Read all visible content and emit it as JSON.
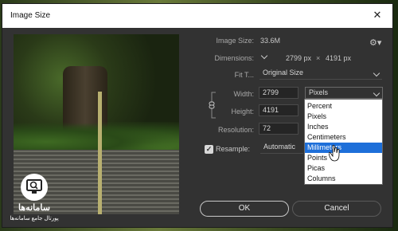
{
  "dialog": {
    "title": "Image Size"
  },
  "info": {
    "image_size_label": "Image Size:",
    "image_size_value": "33.6M",
    "dimensions_label": "Dimensions:",
    "dimensions_width": "2799 px",
    "dimensions_times": "×",
    "dimensions_height": "4191 px",
    "fit_label": "Fit T...",
    "fit_value": "Original Size"
  },
  "fields": {
    "width_label": "Width:",
    "width_value": "2799",
    "width_unit": "Pixels",
    "height_label": "Height:",
    "height_value": "4191",
    "resolution_label": "Resolution:",
    "resolution_value": "72",
    "resample_label": "Resample:",
    "resample_value": "Automatic"
  },
  "unit_options": [
    "Percent",
    "Pixels",
    "Inches",
    "Centimeters",
    "Millimeters",
    "Points",
    "Picas",
    "Columns"
  ],
  "selected_unit_option": "Millimeters",
  "buttons": {
    "ok": "OK",
    "cancel": "Cancel"
  },
  "watermark": {
    "name": "سامانه‌ها",
    "tagline": "پورتال جامع سامانه‌ها"
  },
  "colors": {
    "highlight": "#1e6fd9",
    "dialog_bg": "#323232"
  }
}
